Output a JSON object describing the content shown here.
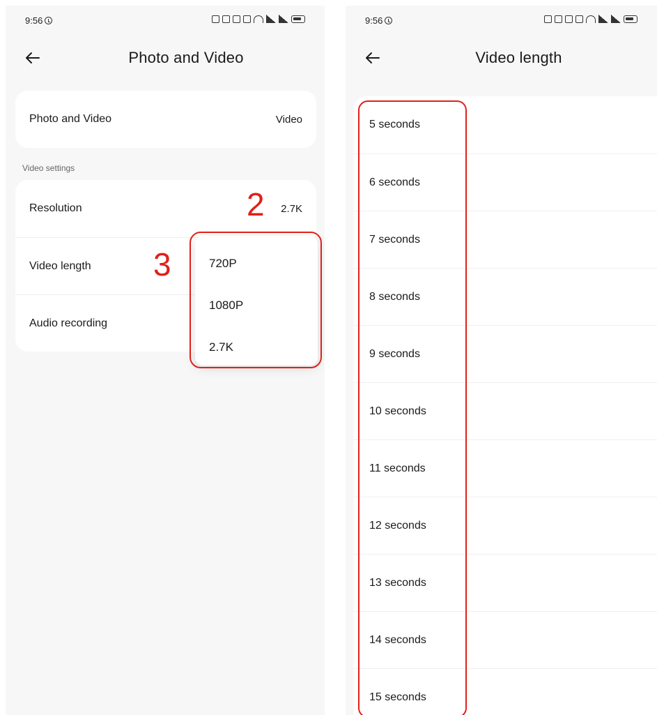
{
  "left_screen": {
    "status_time": "9:56",
    "title": "Photo and Video",
    "mode_row": {
      "label": "Photo and Video",
      "value": "Video"
    },
    "section_label": "Video settings",
    "rows": [
      {
        "label": "Resolution",
        "value": "2.7K"
      },
      {
        "label": "Video length",
        "value": ""
      },
      {
        "label": "Audio recording",
        "value": ""
      }
    ],
    "resolution_options": [
      "720P",
      "1080P",
      "2.7K"
    ],
    "annotations": {
      "step_resolution": "2",
      "step_options": "3"
    }
  },
  "right_screen": {
    "status_time": "9:56",
    "title": "Video length",
    "options": [
      "5 seconds",
      "6 seconds",
      "7 seconds",
      "8 seconds",
      "9 seconds",
      "10 seconds",
      "11 seconds",
      "12 seconds",
      "13 seconds",
      "14 seconds",
      "15 seconds"
    ]
  },
  "colors": {
    "annotation_red": "#e0201a",
    "background": "#f7f7f7",
    "card": "#ffffff"
  },
  "icons": {
    "back": "arrow-left-icon",
    "status": [
      "nfc-icon",
      "cast-icon",
      "bluetooth-icon",
      "vibrate-icon",
      "wifi-icon",
      "signal-icon",
      "signal-icon",
      "battery-icon"
    ]
  }
}
